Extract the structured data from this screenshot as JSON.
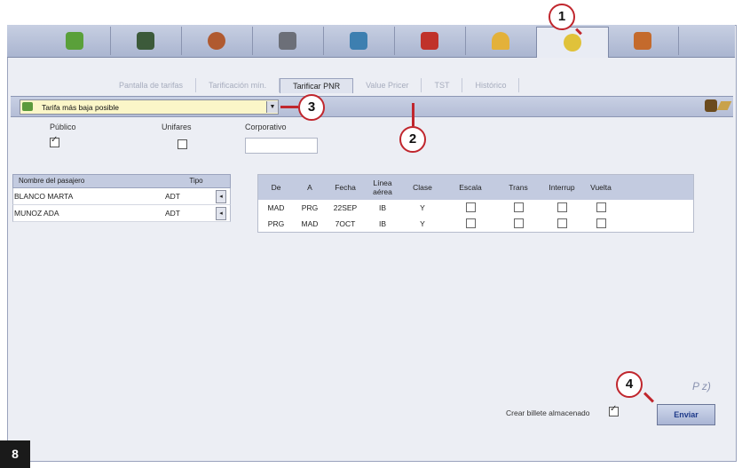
{
  "toolbar": {
    "icons": [
      "cube-icon",
      "building-icon",
      "person-icon",
      "vehicle-icon",
      "car-icon",
      "profile-icon",
      "umbrella-icon",
      "flower-icon",
      "tools-icon"
    ]
  },
  "subtabs": [
    "Pantalla de tarifas",
    "Tarificación mín.",
    "Tarificar PNR",
    "Value Pricer",
    "TST",
    "Histórico"
  ],
  "fare_select": {
    "value": "Tarifa más baja posible"
  },
  "options": {
    "publico": "Público",
    "unifares": "Unifares",
    "corporativo": "Corporativo"
  },
  "passengers": {
    "headers": [
      "Nombre del pasajero",
      "Tipo"
    ],
    "rows": [
      {
        "name": "BLANCO MARTA",
        "type": "ADT"
      },
      {
        "name": "MUNOZ ADA",
        "type": "ADT"
      }
    ]
  },
  "segments": {
    "headers": [
      "De",
      "A",
      "Fecha",
      "Línea aérea",
      "Clase",
      "Escala",
      "Trans",
      "Interrup",
      "Vuelta"
    ],
    "rows": [
      {
        "de": "MAD",
        "a": "PRG",
        "fecha": "22SEP",
        "linea": "IB",
        "clase": "Y"
      },
      {
        "de": "PRG",
        "a": "MAD",
        "fecha": "7OCT",
        "linea": "IB",
        "clase": "Y"
      }
    ]
  },
  "footer": {
    "store_label": "Crear billete almacenado",
    "send_label": "Enviar",
    "pz_label": "P z)"
  },
  "callouts": {
    "c1": "1",
    "c2": "2",
    "c3": "3",
    "c4": "4",
    "page": "8"
  }
}
